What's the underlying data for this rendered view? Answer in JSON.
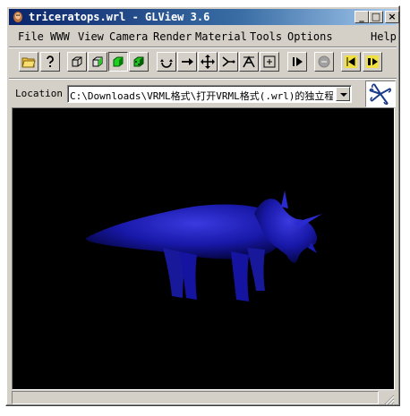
{
  "window": {
    "title": "triceratops.wrl - GLView 3.6",
    "controls": {
      "minimize": "_",
      "maximize": "□",
      "close": "×"
    }
  },
  "menu": [
    "File",
    "WWW",
    "View",
    "Camera",
    "Render",
    "Material",
    "Tools",
    "Options",
    "Help"
  ],
  "toolbar": {
    "buttons": [
      "open-folder-icon",
      "help-cursor-icon",
      "wireframe-cube-icon",
      "flat-cube-icon",
      "smooth-cube-icon",
      "textured-cube-icon",
      "rotate-icon",
      "translate-icon",
      "move-icon",
      "walk-icon",
      "fly-icon",
      "target-icon",
      "play-icon",
      "stop-icon",
      "prev-viewpoint-icon",
      "next-viewpoint-icon"
    ],
    "pressed": "smooth-cube-icon"
  },
  "location": {
    "label": "Location",
    "value": "C:\\Downloads\\VRML格式\\打开VRML格式(.wrl)的独立程"
  },
  "viewport": {
    "background": "#000000",
    "model_color": "#1a1aa0"
  },
  "status": {
    "text": ""
  }
}
